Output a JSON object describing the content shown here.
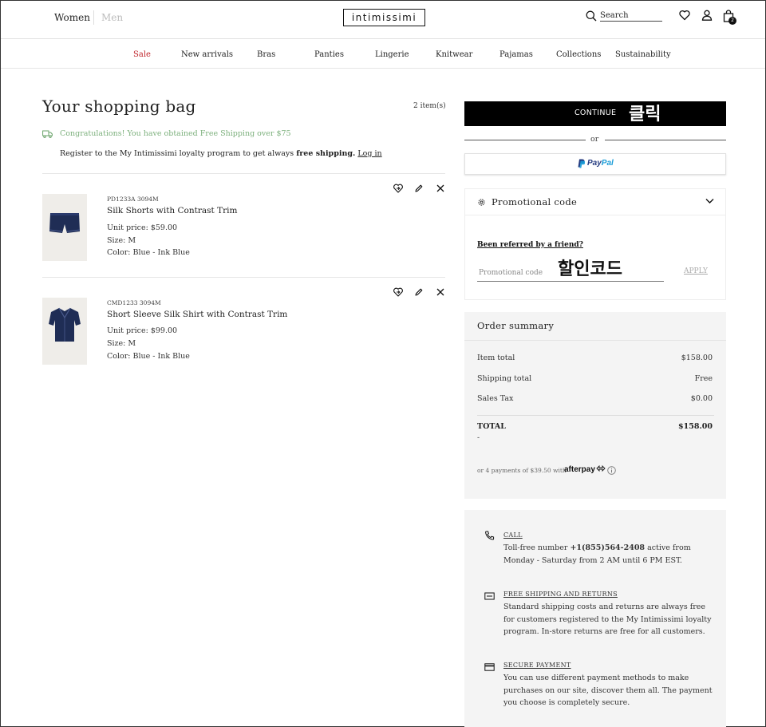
{
  "header": {
    "women": "Women",
    "men": "Men",
    "logo": "intimissimi",
    "search_placeholder": "Search",
    "bag_count": "2"
  },
  "categories": [
    "Sale",
    "New arrivals",
    "Bras",
    "Panties",
    "Lingerie",
    "Knitwear",
    "Pajamas",
    "Collections",
    "Sustainability"
  ],
  "colors": {
    "sale": "#c0272d",
    "congrats": "#7cb07c",
    "paypal_dark": "#253b80",
    "paypal_light": "#179bd7"
  },
  "bag": {
    "title": "Your shopping bag",
    "count": "2 item(s)",
    "free_shipping": "Congratulations! You have obtained Free Shipping over $75",
    "register_text": "Register to the My Intimissimi loyalty program to get always ",
    "register_bold": "free shipping.",
    "login_link": "Log in"
  },
  "items": [
    {
      "code": "PD1233A 3094M",
      "name": "Silk Shorts with Contrast Trim",
      "unit_price": "Unit price: $59.00",
      "size": "Size: M",
      "color": "Color: Blue - Ink Blue"
    },
    {
      "code": "CMD1233 3094M",
      "name": "Short Sleeve Silk Shirt with Contrast Trim",
      "unit_price": "Unit price: $99.00",
      "size": "Size: M",
      "color": "Color: Blue - Ink Blue"
    }
  ],
  "checkout": {
    "continue_label": "CONTINUE",
    "annotation_click": "클릭",
    "or": "or",
    "paypal_pay": "Pay",
    "paypal_pal": "Pal"
  },
  "promo": {
    "title": "Promotional code",
    "referred": "Been referred by a friend?",
    "placeholder": "Promotional code",
    "annotation_code": "할인코드",
    "apply": "APPLY"
  },
  "summary": {
    "title": "Order summary",
    "item_total_label": "Item total",
    "item_total_value": "$158.00",
    "shipping_label": "Shipping total",
    "shipping_value": "Free",
    "tax_label": "Sales Tax",
    "tax_value": "$0.00",
    "total_label": "TOTAL",
    "total_value": "$158.00",
    "total_dash": "-",
    "afterpay_text": "or 4 payments of $39.50 with",
    "afterpay_logo": "afterpay"
  },
  "help": {
    "call_title": "CALL",
    "call_text_1": "Toll-free number ",
    "call_number": "+1(855)564-2408",
    "call_text_2": " active from Monday - Saturday from 2 AM until 6 PM EST.",
    "ship_title": "FREE SHIPPING AND RETURNS",
    "ship_text": "Standard shipping costs and returns are always free for customers registered to the My Intimissimi loyalty program. In-store returns are free for all customers.",
    "pay_title": "SECURE PAYMENT",
    "pay_text": "You can use different payment methods to make purchases on our site, discover them all. The payment you choose is completely secure."
  }
}
